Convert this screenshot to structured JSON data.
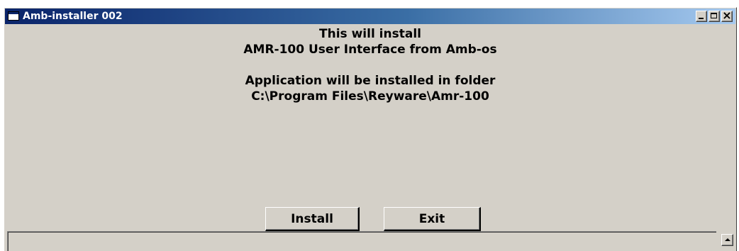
{
  "window": {
    "title": "Amb-installer 002",
    "icons": [
      "app-window-icon",
      "minimize-icon",
      "maximize-icon",
      "close-icon",
      "scroll-up-arrow-icon"
    ]
  },
  "message": {
    "line1": "This will install",
    "line2": "AMR-100 User Interface from Amb-os",
    "line3": "Application will be installed in folder",
    "line4": "C:\\Program Files\\Reyware\\Amr-100"
  },
  "buttons": {
    "install_label": "Install",
    "exit_label": "Exit"
  },
  "log": {
    "value": ""
  },
  "colors": {
    "window_bg": "#d4d0c8",
    "titlebar_start": "#0a246a",
    "titlebar_end": "#a6caf0"
  }
}
